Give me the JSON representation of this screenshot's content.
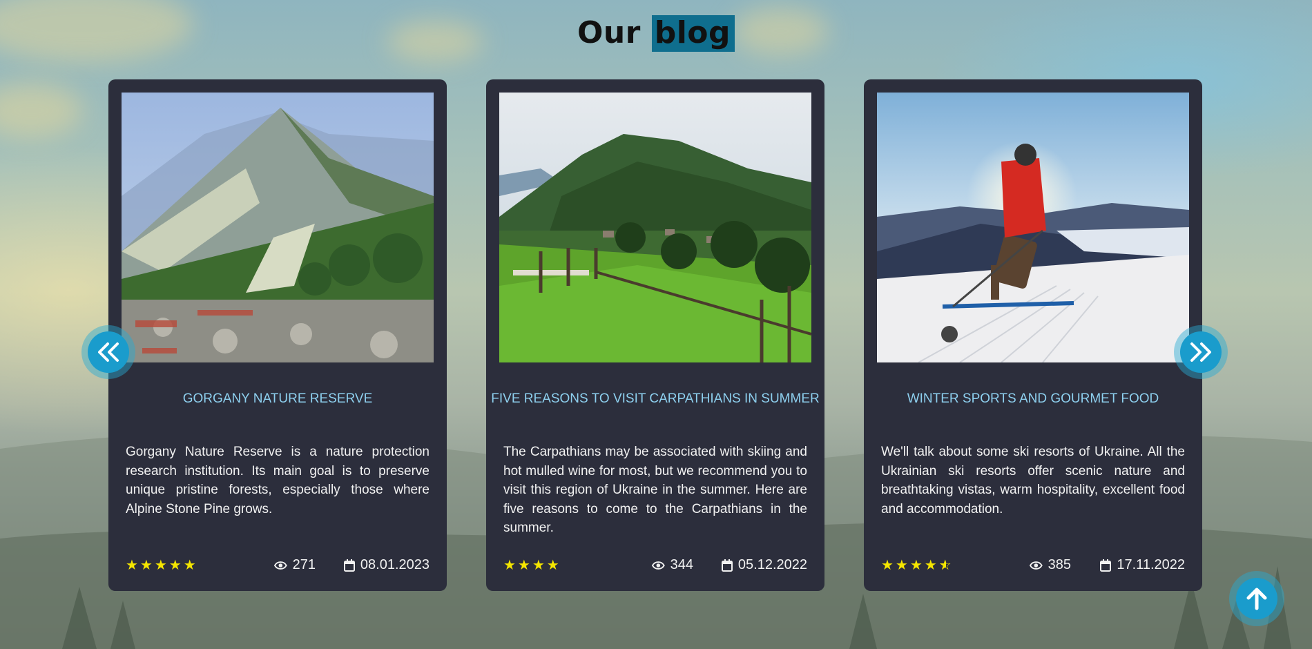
{
  "page": {
    "title_prefix": "Our",
    "title_highlight": "blog"
  },
  "colors": {
    "card_bg": "#2c2e3c",
    "card_title": "#8ed0ef",
    "star": "#f5e600",
    "accent": "#1a9ccc",
    "title_highlight_bg": "#0f6e8e"
  },
  "navigation": {
    "prev_icon": "double-chevron-left-icon",
    "next_icon": "double-chevron-right-icon",
    "scroll_top_icon": "arrow-up-icon"
  },
  "posts": [
    {
      "image": "mountain-ridge-photo",
      "title": "GORGANY NATURE RESERVE",
      "text": "Gorgany Nature Reserve is a nature protection research institution. Its main goal is to preserve unique pristine forests, especially those where Alpine Stone Pine grows.",
      "rating": 5,
      "rating_display": "★★★★★",
      "views": "271",
      "date": "08.01.2023"
    },
    {
      "image": "carpathian-village-photo",
      "title": "FIVE REASONS TO VISIT CARPATHIANS IN SUMMER",
      "text": "The Carpathians may be associated with skiing and hot mulled wine for most, but we recommend you to visit this region of Ukraine in the summer. Here are five reasons to come to the Carpathians in the summer.",
      "rating": 4,
      "rating_display": "★★★★",
      "views": "344",
      "date": "05.12.2022"
    },
    {
      "image": "skier-photo",
      "title": "WINTER SPORTS AND GOURMET FOOD",
      "text": "We'll talk about some ski resorts of Ukraine. All the Ukrainian ski resorts offer scenic nature and breathtaking vistas, warm hospitality, excellent food and accommodation.",
      "rating": 4.5,
      "rating_display": "★★★★",
      "views": "385",
      "date": "17.11.2022"
    }
  ]
}
